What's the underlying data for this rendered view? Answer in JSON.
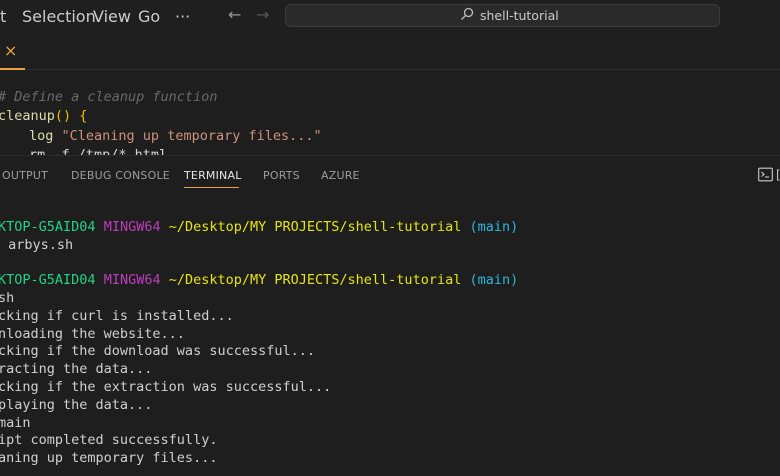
{
  "titlebar": {
    "menu": [
      "t",
      "Selection",
      "View",
      "Go",
      "···"
    ],
    "search_text": "shell-tutorial"
  },
  "editor": {
    "tab_close_glyph": "×",
    "lines": {
      "comment": "# Define a cleanup function",
      "fn_name": "cleanup",
      "fn_parens": "()",
      "fn_brace": " {",
      "log_cmd": "log",
      "log_string": "\"Cleaning up temporary files...\"",
      "partial_line": "rm -f /tmp/*.html"
    }
  },
  "panel": {
    "tabs": [
      "OUTPUT",
      "DEBUG CONSOLE",
      "TERMINAL",
      "PORTS",
      "AZURE"
    ],
    "active_tab": "TERMINAL"
  },
  "terminal": {
    "prompt_host": "KTOP-G5AID04",
    "prompt_mingw": "MINGW64",
    "prompt_path": "~/Desktop/MY PROJECTS/shell-tutorial",
    "prompt_branch": "(main)",
    "cmd1": " arbys.sh",
    "cmd2": "sh",
    "output": [
      "cking if curl is installed...",
      "nloading the website...",
      "cking if the download was successful...",
      "racting the data...",
      "cking if the extraction was successful...",
      "playing the data...",
      "main",
      "ipt completed successfully.",
      "aning up temporary files..."
    ]
  },
  "colors": {
    "accent": "#e8a33d",
    "host_green": "#23d18b",
    "mingw_magenta": "#bc3fbc",
    "path_yellow": "#e5e510",
    "branch_cyan": "#29b8db"
  },
  "icons": [
    "search-icon",
    "back-arrow-icon",
    "forward-arrow-icon",
    "close-icon",
    "terminal-icon"
  ]
}
